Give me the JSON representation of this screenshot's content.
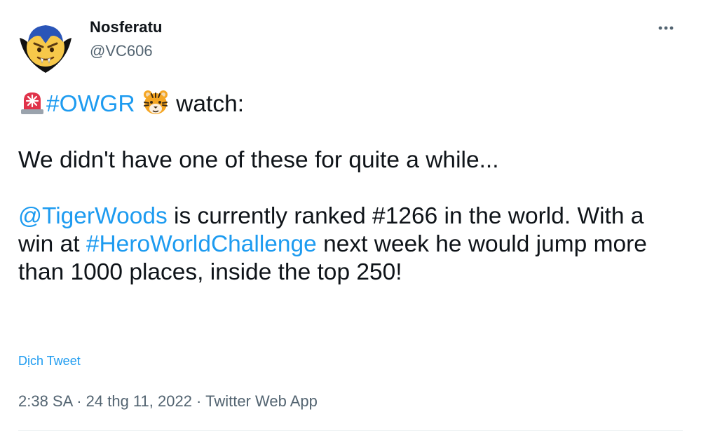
{
  "author": {
    "display_name": "Nosferatu",
    "handle": "@VC606",
    "avatar_icon": "vampire-emoji-avatar-icon"
  },
  "more_icon": "more-horizontal-icon",
  "tweet": {
    "line1": {
      "emoji_1": "rotating-light-icon",
      "hashtag": "#OWGR",
      "emoji_2": "tiger-face-icon",
      "suffix": " watch:"
    },
    "line2": "We didn't have one of these for quite a while...",
    "para3": {
      "mention": "@TigerWoods",
      "text_a": " is currently ranked #1266 in the world. With a win at ",
      "hashtag": "#HeroWorldChallenge",
      "text_b": " next week he would jump more than 1000 places, inside the top 250!"
    }
  },
  "translate_label": "Dịch Tweet",
  "meta": {
    "time": "2:38 SA",
    "sep1": " · ",
    "date": "24 thg 11, 2022",
    "sep2": " · ",
    "source": "Twitter Web App"
  },
  "colors": {
    "link": "#1d9bf0",
    "secondary": "#536471",
    "text": "#0f1419"
  }
}
